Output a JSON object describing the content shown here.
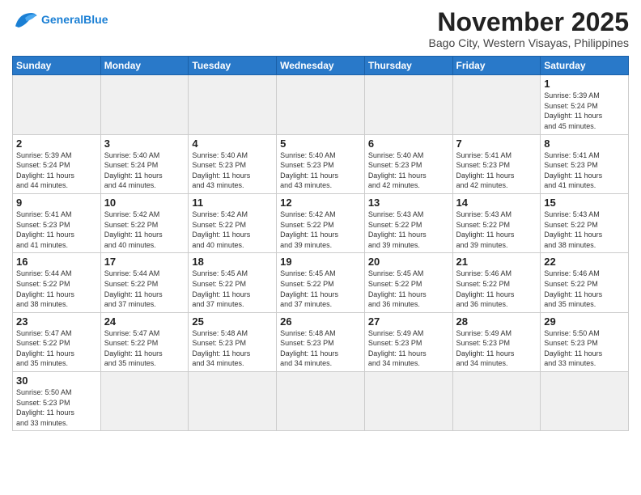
{
  "header": {
    "logo_general": "General",
    "logo_blue": "Blue",
    "month_title": "November 2025",
    "location": "Bago City, Western Visayas, Philippines"
  },
  "days_of_week": [
    "Sunday",
    "Monday",
    "Tuesday",
    "Wednesday",
    "Thursday",
    "Friday",
    "Saturday"
  ],
  "weeks": [
    [
      {
        "day": "",
        "info": ""
      },
      {
        "day": "",
        "info": ""
      },
      {
        "day": "",
        "info": ""
      },
      {
        "day": "",
        "info": ""
      },
      {
        "day": "",
        "info": ""
      },
      {
        "day": "",
        "info": ""
      },
      {
        "day": "1",
        "info": "Sunrise: 5:39 AM\nSunset: 5:24 PM\nDaylight: 11 hours\nand 45 minutes."
      }
    ],
    [
      {
        "day": "2",
        "info": "Sunrise: 5:39 AM\nSunset: 5:24 PM\nDaylight: 11 hours\nand 44 minutes."
      },
      {
        "day": "3",
        "info": "Sunrise: 5:40 AM\nSunset: 5:24 PM\nDaylight: 11 hours\nand 44 minutes."
      },
      {
        "day": "4",
        "info": "Sunrise: 5:40 AM\nSunset: 5:23 PM\nDaylight: 11 hours\nand 43 minutes."
      },
      {
        "day": "5",
        "info": "Sunrise: 5:40 AM\nSunset: 5:23 PM\nDaylight: 11 hours\nand 43 minutes."
      },
      {
        "day": "6",
        "info": "Sunrise: 5:40 AM\nSunset: 5:23 PM\nDaylight: 11 hours\nand 42 minutes."
      },
      {
        "day": "7",
        "info": "Sunrise: 5:41 AM\nSunset: 5:23 PM\nDaylight: 11 hours\nand 42 minutes."
      },
      {
        "day": "8",
        "info": "Sunrise: 5:41 AM\nSunset: 5:23 PM\nDaylight: 11 hours\nand 41 minutes."
      }
    ],
    [
      {
        "day": "9",
        "info": "Sunrise: 5:41 AM\nSunset: 5:23 PM\nDaylight: 11 hours\nand 41 minutes."
      },
      {
        "day": "10",
        "info": "Sunrise: 5:42 AM\nSunset: 5:22 PM\nDaylight: 11 hours\nand 40 minutes."
      },
      {
        "day": "11",
        "info": "Sunrise: 5:42 AM\nSunset: 5:22 PM\nDaylight: 11 hours\nand 40 minutes."
      },
      {
        "day": "12",
        "info": "Sunrise: 5:42 AM\nSunset: 5:22 PM\nDaylight: 11 hours\nand 39 minutes."
      },
      {
        "day": "13",
        "info": "Sunrise: 5:43 AM\nSunset: 5:22 PM\nDaylight: 11 hours\nand 39 minutes."
      },
      {
        "day": "14",
        "info": "Sunrise: 5:43 AM\nSunset: 5:22 PM\nDaylight: 11 hours\nand 39 minutes."
      },
      {
        "day": "15",
        "info": "Sunrise: 5:43 AM\nSunset: 5:22 PM\nDaylight: 11 hours\nand 38 minutes."
      }
    ],
    [
      {
        "day": "16",
        "info": "Sunrise: 5:44 AM\nSunset: 5:22 PM\nDaylight: 11 hours\nand 38 minutes."
      },
      {
        "day": "17",
        "info": "Sunrise: 5:44 AM\nSunset: 5:22 PM\nDaylight: 11 hours\nand 37 minutes."
      },
      {
        "day": "18",
        "info": "Sunrise: 5:45 AM\nSunset: 5:22 PM\nDaylight: 11 hours\nand 37 minutes."
      },
      {
        "day": "19",
        "info": "Sunrise: 5:45 AM\nSunset: 5:22 PM\nDaylight: 11 hours\nand 37 minutes."
      },
      {
        "day": "20",
        "info": "Sunrise: 5:45 AM\nSunset: 5:22 PM\nDaylight: 11 hours\nand 36 minutes."
      },
      {
        "day": "21",
        "info": "Sunrise: 5:46 AM\nSunset: 5:22 PM\nDaylight: 11 hours\nand 36 minutes."
      },
      {
        "day": "22",
        "info": "Sunrise: 5:46 AM\nSunset: 5:22 PM\nDaylight: 11 hours\nand 35 minutes."
      }
    ],
    [
      {
        "day": "23",
        "info": "Sunrise: 5:47 AM\nSunset: 5:22 PM\nDaylight: 11 hours\nand 35 minutes."
      },
      {
        "day": "24",
        "info": "Sunrise: 5:47 AM\nSunset: 5:22 PM\nDaylight: 11 hours\nand 35 minutes."
      },
      {
        "day": "25",
        "info": "Sunrise: 5:48 AM\nSunset: 5:23 PM\nDaylight: 11 hours\nand 34 minutes."
      },
      {
        "day": "26",
        "info": "Sunrise: 5:48 AM\nSunset: 5:23 PM\nDaylight: 11 hours\nand 34 minutes."
      },
      {
        "day": "27",
        "info": "Sunrise: 5:49 AM\nSunset: 5:23 PM\nDaylight: 11 hours\nand 34 minutes."
      },
      {
        "day": "28",
        "info": "Sunrise: 5:49 AM\nSunset: 5:23 PM\nDaylight: 11 hours\nand 34 minutes."
      },
      {
        "day": "29",
        "info": "Sunrise: 5:50 AM\nSunset: 5:23 PM\nDaylight: 11 hours\nand 33 minutes."
      }
    ],
    [
      {
        "day": "30",
        "info": "Sunrise: 5:50 AM\nSunset: 5:23 PM\nDaylight: 11 hours\nand 33 minutes."
      },
      {
        "day": "",
        "info": ""
      },
      {
        "day": "",
        "info": ""
      },
      {
        "day": "",
        "info": ""
      },
      {
        "day": "",
        "info": ""
      },
      {
        "day": "",
        "info": ""
      },
      {
        "day": "",
        "info": ""
      }
    ]
  ]
}
